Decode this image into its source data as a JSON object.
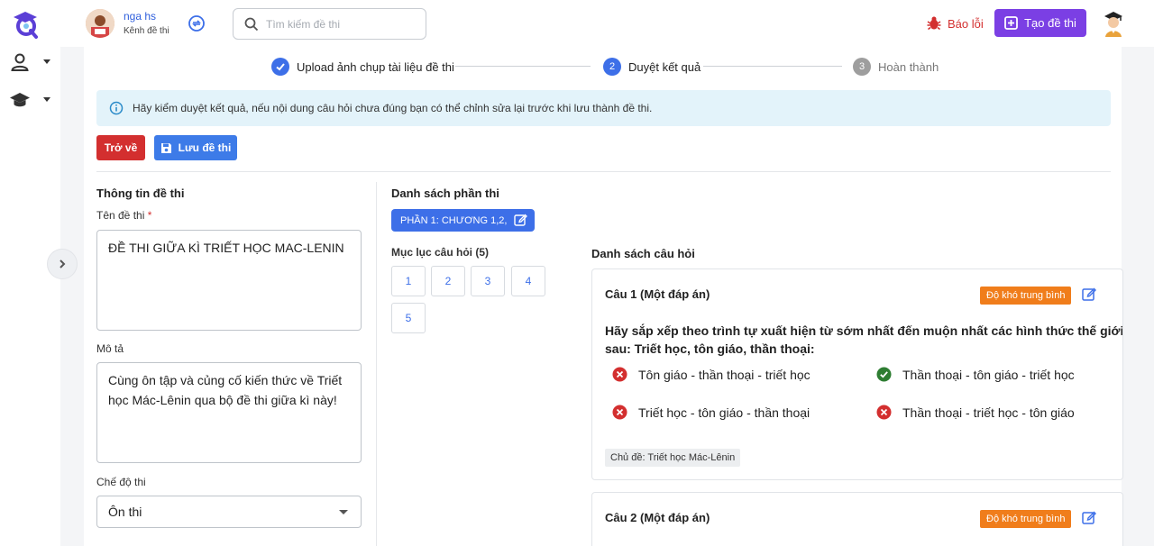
{
  "header": {
    "channel_name": "nga hs",
    "channel_sub": "Kênh đề thi",
    "search_placeholder": "Tìm kiếm đề thi",
    "report_label": "Báo lỗi",
    "create_label": "Tạo đề thi"
  },
  "stepper": [
    {
      "num": "✓",
      "label": "Upload ảnh chụp tài liệu đề thi",
      "state": "done"
    },
    {
      "num": "2",
      "label": "Duyệt kết quả",
      "state": "active"
    },
    {
      "num": "3",
      "label": "Hoàn thành",
      "state": "pending"
    }
  ],
  "info_text": "Hãy kiểm duyệt kết quả, nếu nội dung câu hỏi chưa đúng bạn có thể chỉnh sửa lại trước khi lưu thành đề thi.",
  "actions": {
    "back_label": "Trở về",
    "save_label": "Lưu đề thi"
  },
  "exam_info": {
    "section_title": "Thông tin đề thi",
    "name_label": "Tên đề thi",
    "name_required": "*",
    "name_value": "ĐỀ THI GIỮA KÌ TRIẾT HỌC MAC-LENIN",
    "desc_label": "Mô tả",
    "desc_value": "Cùng ôn tập và củng cố kiến thức về Triết học Mác-Lênin qua bộ đề thi giữa kì này!",
    "mode_label": "Chế độ thi",
    "mode_value": "Ôn thi"
  },
  "parts": {
    "section_title": "Danh sách phần thi",
    "part_label": "PHẦN 1: CHƯƠNG 1,2,",
    "toc_label": "Mục lục câu hỏi (5)",
    "toc": [
      "1",
      "2",
      "3",
      "4",
      "5"
    ]
  },
  "questions": {
    "section_title": "Danh sách câu hỏi",
    "items": [
      {
        "title": "Câu 1 (Một đáp án)",
        "difficulty": "Độ khó trung bình",
        "text_line1": "Hãy sắp xếp theo trình tự xuất hiện từ sớm nhất đến muộn nhất các hình thức thế giới qu",
        "text_line2": "sau: Triết học, tôn giáo, thần thoại:",
        "options": [
          {
            "text": "Tôn giáo - thần thoại - triết học",
            "correct": false
          },
          {
            "text": "Thần thoại - tôn giáo - triết học",
            "correct": true
          },
          {
            "text": "Triết học - tôn giáo - thần thoại",
            "correct": false
          },
          {
            "text": "Thần thoại - triết học - tôn giáo",
            "correct": false
          }
        ],
        "topic": "Chủ đề: Triết học Mác-Lênin"
      },
      {
        "title": "Câu 2 (Một đáp án)",
        "difficulty": "Độ khó trung bình"
      }
    ]
  },
  "colors": {
    "primary": "#3d6fe8",
    "danger": "#d32f2f",
    "purple": "#7b3fe4",
    "orange": "#f07d1b",
    "success": "#2e7d32"
  }
}
